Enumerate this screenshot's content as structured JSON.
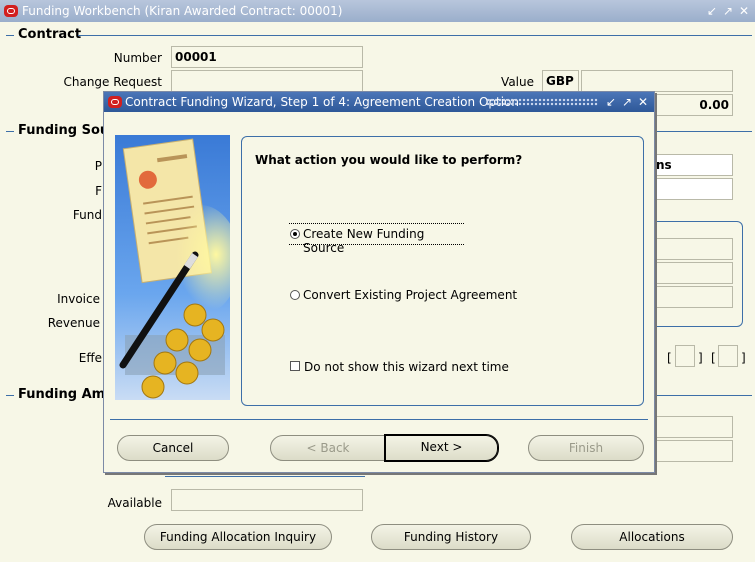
{
  "window": {
    "title": "Funding Workbench (Kiran Awarded Contract: 00001)",
    "controls": [
      "↙",
      "↗",
      "✕"
    ]
  },
  "contract": {
    "section": "Contract",
    "number_label": "Number",
    "number_value": "00001",
    "change_request_label": "Change Request",
    "value_label": "Value",
    "currency": "GBP",
    "amount": "0.00"
  },
  "funding_source": {
    "section": "Funding Sour",
    "labels": [
      "P",
      "F",
      "Fund",
      "Invoice",
      "Revenue",
      "Effe"
    ],
    "right_field_text": "ns"
  },
  "funding_amount": {
    "section": "Funding Amo",
    "available_label": "Available"
  },
  "bottom_buttons": {
    "inquiry": "Funding Allocation Inquiry",
    "history": "Funding History",
    "allocations": "Allocations"
  },
  "wizard": {
    "title": "Contract Funding Wizard, Step 1 of 4: Agreement Creation Option",
    "controls": [
      "↙",
      "↗",
      "✕"
    ],
    "question": "What action you would like to perform?",
    "option_create": "Create New Funding Source",
    "option_convert": "Convert Existing Project Agreement",
    "checkbox_label": "Do not show this wizard next time",
    "buttons": {
      "cancel": "Cancel",
      "back": "< Back",
      "next": "Next >",
      "finish": "Finish"
    }
  },
  "colors": {
    "accent": "#3d6fa8",
    "titlebar": "#2e5898",
    "background": "#f7f7e7",
    "oracle_red": "#d21f1f"
  }
}
